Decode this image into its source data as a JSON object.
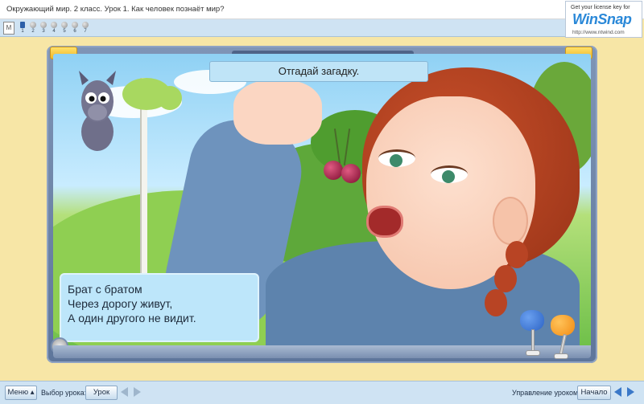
{
  "window": {
    "title": "Окружающий мир. 2 класс. Урок 1. Как человек познаёт мир?"
  },
  "watermark": {
    "line1": "Get your license key for",
    "brand": "WinSnap",
    "url": "http://www.ntwind.com"
  },
  "steps": {
    "items": [
      "1",
      "2",
      "3",
      "4",
      "5",
      "6",
      "7"
    ],
    "active_index": 0
  },
  "slide": {
    "caption": "Отгадай загадку.",
    "riddle_lines": [
      "Брат с братом",
      "Через дорогу живут,",
      "А один другого не видит."
    ]
  },
  "toolbar": {
    "menu_label": "Меню",
    "lesson_select_label": "Выбор урока:",
    "lesson_button": "Урок",
    "control_label": "Управление уроком:",
    "start_button": "Начало"
  },
  "colors": {
    "frame": "#6f86aa",
    "caption_bg": "#bfe4f7",
    "knob_blue": "#2c63c4",
    "knob_orange": "#f28a12",
    "accent_yellow": "#f0b624"
  },
  "icons": {
    "arrow_left": "arrow-left-icon",
    "arrow_right": "arrow-right-icon"
  }
}
